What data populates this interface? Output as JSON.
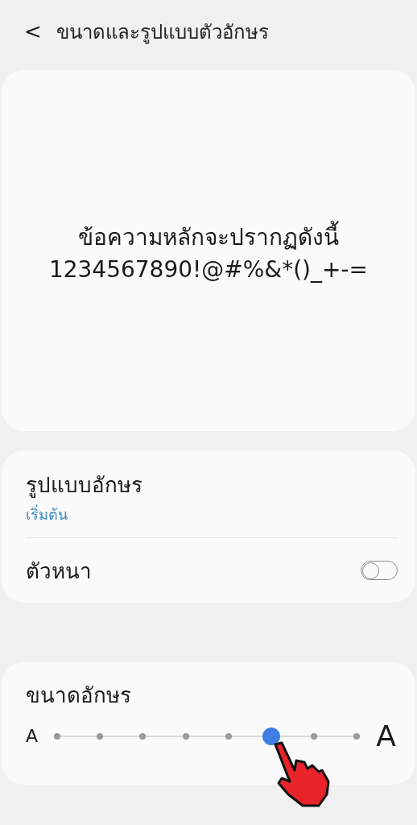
{
  "header": {
    "back": "<",
    "title": "ขนาดและรูปแบบตัวอักษร"
  },
  "preview": {
    "lines": [
      "ข้อความหลักจะปรากฏดังนี้",
      "1234567890!@#%&*()_+-="
    ]
  },
  "font_settings": {
    "style": {
      "label": "รูปแบบอักษร",
      "value": "เริ่มต้น"
    },
    "bold": {
      "label": "ตัวหนา",
      "on": false
    }
  },
  "font_size": {
    "label": "ขนาดอักษร",
    "small_mark": "A",
    "large_mark": "A",
    "level": 0.714
  }
}
